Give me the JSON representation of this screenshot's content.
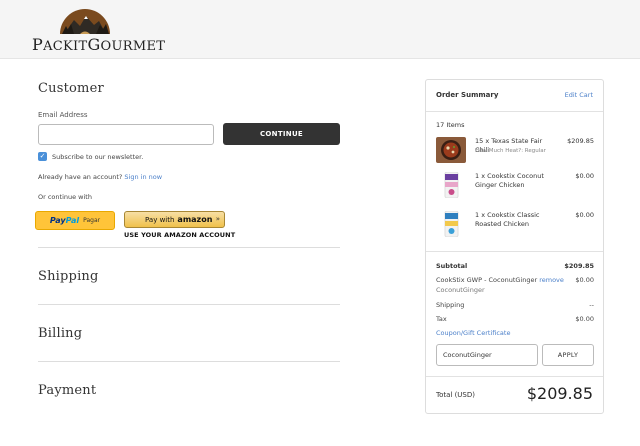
{
  "brand": {
    "logo_text": "PACKITGOURMET",
    "logo_first": "P",
    "logo_mid": "ACKIT",
    "logo_g": "G",
    "logo_rest": "OURMET"
  },
  "customer": {
    "title": "Customer",
    "email_label": "Email Address",
    "email_value": "",
    "continue_label": "CONTINUE",
    "subscribe_label": "Subscribe to our newsletter.",
    "subscribe_checked": true,
    "account_text": "Already have an account?",
    "signin_label": "Sign in now",
    "continue_with": "Or continue with",
    "paypal": {
      "pay": "Pay",
      "pal": "Pal",
      "pagar": "Pagar"
    },
    "amazon": {
      "pay_with": "Pay with",
      "amazon": "amazon",
      "arrows": "»",
      "sub": "USE YOUR AMAZON ACCOUNT"
    }
  },
  "sections": {
    "shipping": "Shipping",
    "billing": "Billing",
    "payment": "Payment"
  },
  "summary": {
    "title": "Order Summary",
    "edit_cart": "Edit Cart",
    "items_count": "17 Items",
    "items": [
      {
        "name": "15 x Texas State Fair Chili",
        "option": "How Much Heat?: Regular",
        "price": "$209.85",
        "image": "chili-bowl-image"
      },
      {
        "name": "1 x Cookstix Coconut Ginger Chicken",
        "option": "",
        "price": "$0.00",
        "image": "cookstix-package-image"
      },
      {
        "name": "1 x Cookstix Classic Roasted Chicken",
        "option": "",
        "price": "$0.00",
        "image": "cookstix-package-image"
      }
    ],
    "subtotal_label": "Subtotal",
    "subtotal_value": "$209.85",
    "gwp_label": "CookStix GWP - CoconutGinger",
    "gwp_remove": "remove",
    "gwp_code": "CoconutGinger",
    "gwp_value": "$0.00",
    "shipping_label": "Shipping",
    "shipping_value": "--",
    "tax_label": "Tax",
    "tax_value": "$0.00",
    "coupon_link": "Coupon/Gift Certificate",
    "coupon_value": "CoconutGinger",
    "apply_label": "APPLY",
    "total_label": "Total (USD)",
    "total_value": "$209.85"
  },
  "colors": {
    "accent_link": "#4a7fc9",
    "dark_button": "#333333",
    "paypal_yellow": "#ffc439",
    "amazon_gold": "#f0c14b"
  }
}
